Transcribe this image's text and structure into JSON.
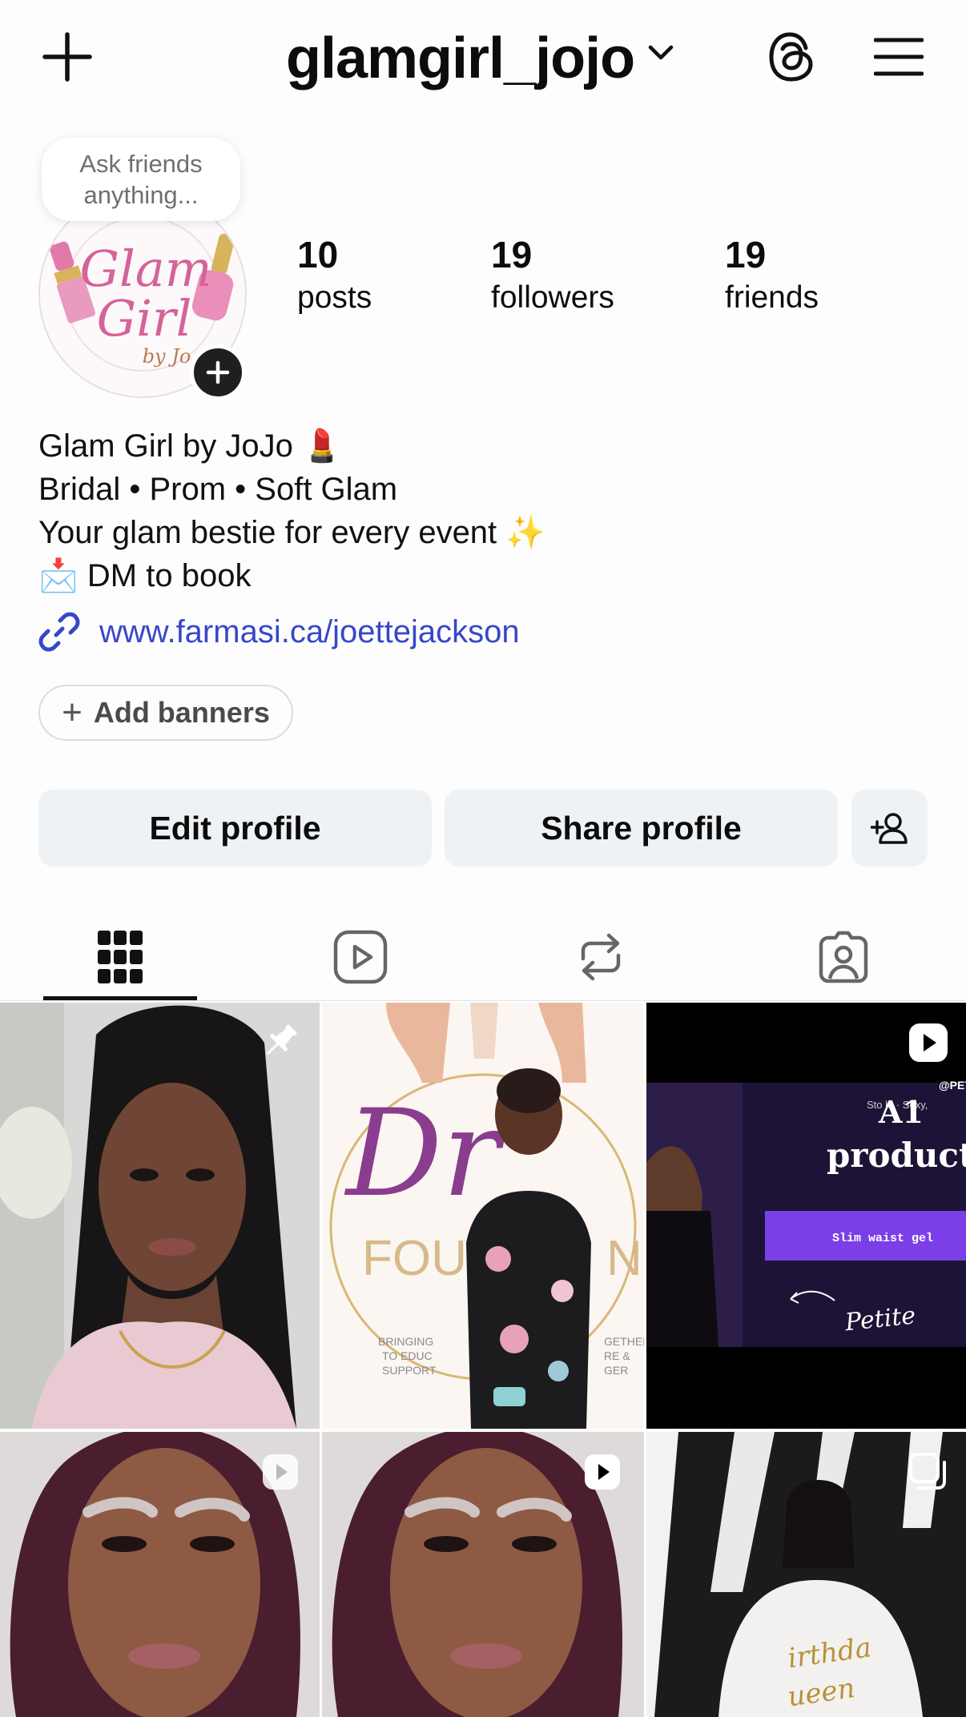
{
  "header": {
    "username": "glamgirl_jojo",
    "icons": [
      "plus-icon",
      "chevron-down-icon",
      "threads-icon",
      "menu-icon"
    ]
  },
  "note": {
    "text": "Ask friends anything..."
  },
  "avatar": {
    "logo_text": "Glam Girl by Jo"
  },
  "stats": [
    {
      "count": "10",
      "label": "posts"
    },
    {
      "count": "19",
      "label": "followers"
    },
    {
      "count": "19",
      "label": "friends"
    }
  ],
  "bio": {
    "line1": "Glam Girl by JoJo 💄",
    "line2": "Bridal • Prom • Soft Glam",
    "line3": "Your glam bestie for every event ✨",
    "line4": "📩 DM to book",
    "link": "www.farmasi.ca/joettejackson"
  },
  "add_banners": "Add banners",
  "buttons": {
    "edit": "Edit profile",
    "share": "Share profile"
  },
  "tabs": [
    "grid-icon",
    "reels-icon",
    "reposts-icon",
    "tagged-icon"
  ],
  "posts": {
    "post2": {
      "big_text": "Dr",
      "text_left": "BRINGING\nTO EDUC\nSUPPORT",
      "text_right": "GETHER\nRE &\nGER"
    },
    "post3": {
      "handle": "@PET",
      "sub": "Sto   lo · Sexy,",
      "a1": "A1",
      "products": "products",
      "bar": "Slim waist gel",
      "petite": "Petite"
    },
    "post6": {
      "text": "irthda\nueen"
    }
  },
  "colors": {
    "link": "#3747c9",
    "button_bg": "#eff2f5",
    "accent_pink": "#c94d8d"
  }
}
